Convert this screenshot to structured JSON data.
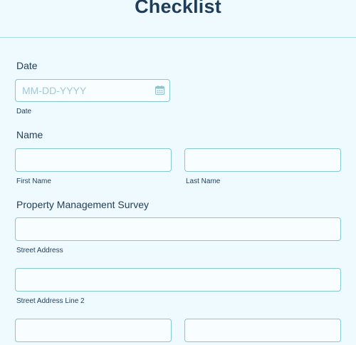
{
  "title": "Checklist",
  "date": {
    "label": "Date",
    "placeholder": "MM-DD-YYYY",
    "sublabel": "Date",
    "icon": "calendar-icon"
  },
  "name": {
    "label": "Name",
    "first_sublabel": "First Name",
    "last_sublabel": "Last Name"
  },
  "survey": {
    "label": "Property Management Survey",
    "street_sublabel": "Street Address",
    "street2_sublabel": "Street Address Line 2"
  },
  "colors": {
    "background": "#eefaff",
    "border": "#86c8d0",
    "text": "#1f3d58",
    "placeholder": "#9fcad6"
  }
}
